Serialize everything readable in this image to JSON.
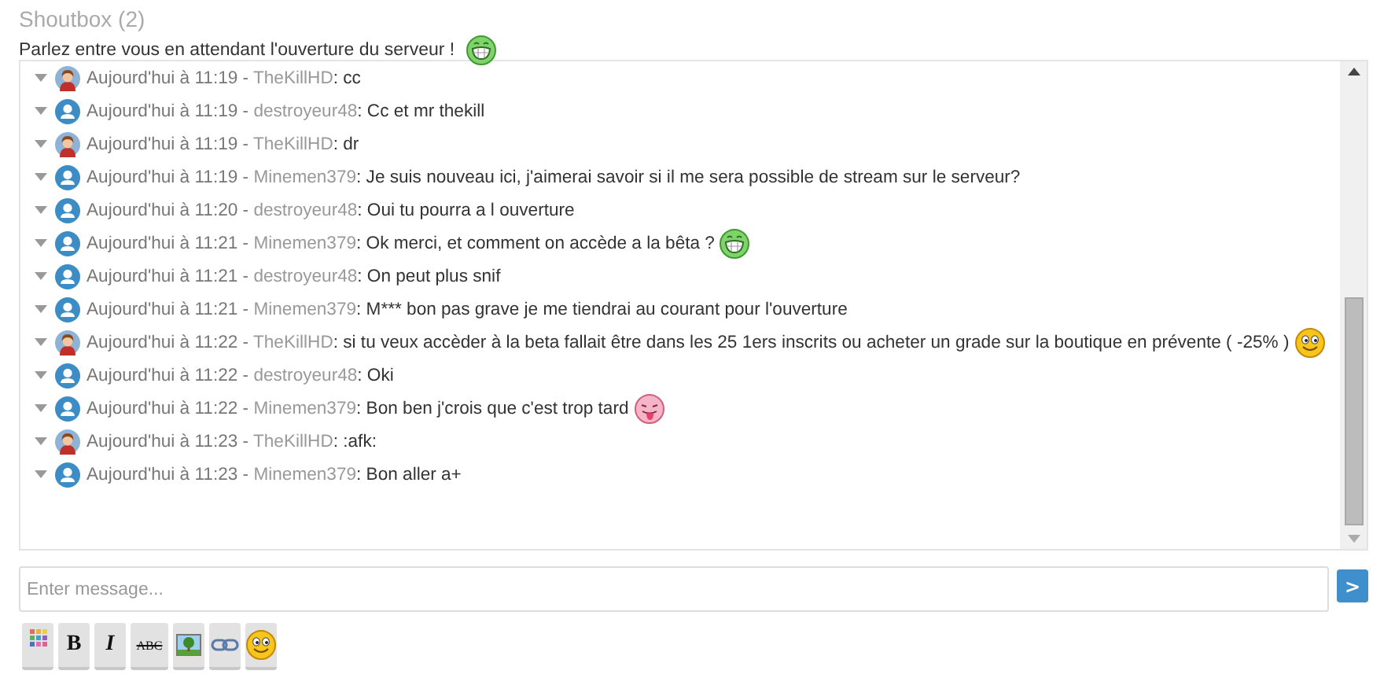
{
  "title": "Shoutbox (2)",
  "subtitle": {
    "text": "Parlez entre vous en attendant l'ouverture du serveur !",
    "emoticon": {
      "kind": "grin"
    }
  },
  "messages": [
    {
      "avatar": {
        "kind": "photo"
      },
      "time": "Aujourd'hui à 11:19 -",
      "user": "TheKillHD",
      "text": ": cc"
    },
    {
      "avatar": {
        "kind": "default"
      },
      "time": "Aujourd'hui à 11:19 -",
      "user": "destroyeur48",
      "text": ": Cc et mr thekill"
    },
    {
      "avatar": {
        "kind": "photo"
      },
      "time": "Aujourd'hui à 11:19 -",
      "user": "TheKillHD",
      "text": ": dr"
    },
    {
      "avatar": {
        "kind": "default"
      },
      "time": "Aujourd'hui à 11:19 -",
      "user": "Minemen379",
      "text": ": Je suis nouveau ici, j'aimerai savoir si il me sera possible de stream sur le serveur?"
    },
    {
      "avatar": {
        "kind": "default"
      },
      "time": "Aujourd'hui à 11:20 -",
      "user": "destroyeur48",
      "text": ": Oui tu pourra a l ouverture"
    },
    {
      "avatar": {
        "kind": "default"
      },
      "time": "Aujourd'hui à 11:21 -",
      "user": "Minemen379",
      "text": ": Ok merci, et comment on accède a la bêta ?",
      "emoticon": {
        "kind": "grin"
      }
    },
    {
      "avatar": {
        "kind": "default"
      },
      "time": "Aujourd'hui à 11:21 -",
      "user": "destroyeur48",
      "text": ": On peut plus snif"
    },
    {
      "avatar": {
        "kind": "default"
      },
      "time": "Aujourd'hui à 11:21 -",
      "user": "Minemen379",
      "text": ": M*** bon pas grave je me tiendrai au courant pour l'ouverture"
    },
    {
      "avatar": {
        "kind": "photo"
      },
      "time": "Aujourd'hui à 11:22 -",
      "user": "TheKillHD",
      "text": ": si tu veux accèder à la beta fallait être dans les 25 1ers inscrits ou acheter un grade sur la boutique en prévente ( -25% )",
      "emoticon": {
        "kind": "smile"
      }
    },
    {
      "avatar": {
        "kind": "default"
      },
      "time": "Aujourd'hui à 11:22 -",
      "user": "destroyeur48",
      "text": ": Oki"
    },
    {
      "avatar": {
        "kind": "default"
      },
      "time": "Aujourd'hui à 11:22 -",
      "user": "Minemen379",
      "text": ": Bon ben j'crois que c'est trop tard",
      "emoticon": {
        "kind": "tongue"
      }
    },
    {
      "avatar": {
        "kind": "photo"
      },
      "time": "Aujourd'hui à 11:23 -",
      "user": "TheKillHD",
      "text": ": :afk:"
    },
    {
      "avatar": {
        "kind": "default"
      },
      "time": "Aujourd'hui à 11:23 -",
      "user": "Minemen379",
      "text": ": Bon aller a+"
    }
  ],
  "input": {
    "placeholder": "Enter message..."
  },
  "send_label": ">",
  "toolbar": [
    {
      "kind": "colors"
    },
    {
      "kind": "bold",
      "label": "B"
    },
    {
      "kind": "italic",
      "label": "I"
    },
    {
      "kind": "strike",
      "label": "ABC"
    },
    {
      "kind": "image"
    },
    {
      "kind": "link"
    },
    {
      "kind": "emoticon"
    }
  ]
}
